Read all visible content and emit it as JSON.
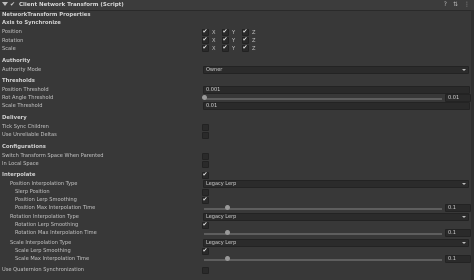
{
  "header": {
    "title": "Client Network Transform (Script)",
    "icons": [
      "help-icon",
      "preset-icon",
      "more-icon"
    ]
  },
  "component_title": "NetworkTransform Properties",
  "axis": {
    "title": "Axis to Synchronize",
    "rows": [
      {
        "label": "Position",
        "x": true,
        "y": true,
        "z": true
      },
      {
        "label": "Rotation",
        "x": true,
        "y": true,
        "z": true
      },
      {
        "label": "Scale",
        "x": true,
        "y": true,
        "z": true
      }
    ],
    "x_label": "X",
    "y_label": "Y",
    "z_label": "Z"
  },
  "authority": {
    "title": "Authority",
    "mode_label": "Authority Mode",
    "mode_value": "Owner"
  },
  "thresholds": {
    "title": "Thresholds",
    "position_label": "Position Threshold",
    "position_value": "0.001",
    "rot_label": "Rot Angle Threshold",
    "rot_value": "0.01",
    "rot_fraction": 0.0,
    "scale_label": "Scale Threshold",
    "scale_value": "0.01"
  },
  "delivery": {
    "title": "Delivery",
    "tick_sync_label": "Tick Sync Children",
    "tick_sync": false,
    "unreliable_label": "Use Unreliable Deltas",
    "unreliable": false
  },
  "configurations": {
    "title": "Configurations",
    "switch_label": "Switch Transform Space When Parented",
    "switch": false,
    "local_label": "In Local Space",
    "local": false
  },
  "interpolate": {
    "title": "Interpolate",
    "enabled": true,
    "pos_type_label": "Position Interpolation Type",
    "pos_type_value": "Legacy Lerp",
    "slerp_label": "Slerp Position",
    "slerp": false,
    "pos_smooth_label": "Position Lerp Smoothing",
    "pos_smooth": true,
    "pos_max_label": "Position Max Interpolation Time",
    "pos_max_value": "0.1",
    "pos_max_fraction": 0.1,
    "rot_type_label": "Rotation Interpolation Type",
    "rot_type_value": "Legacy Lerp",
    "rot_smooth_label": "Rotation Lerp Smoothing",
    "rot_smooth": true,
    "rot_max_label": "Rotation Max Interpolation Time",
    "rot_max_value": "0.1",
    "rot_max_fraction": 0.1,
    "scale_type_label": "Scale Interpolation Type",
    "scale_type_value": "Legacy Lerp",
    "scale_smooth_label": "Scale Lerp Smoothing",
    "scale_smooth": true,
    "scale_max_label": "Scale Max Interpolation Time",
    "scale_max_value": "0.1",
    "scale_max_fraction": 0.1
  },
  "quaternion_label": "Use Quaternion Synchronization",
  "quaternion": false
}
